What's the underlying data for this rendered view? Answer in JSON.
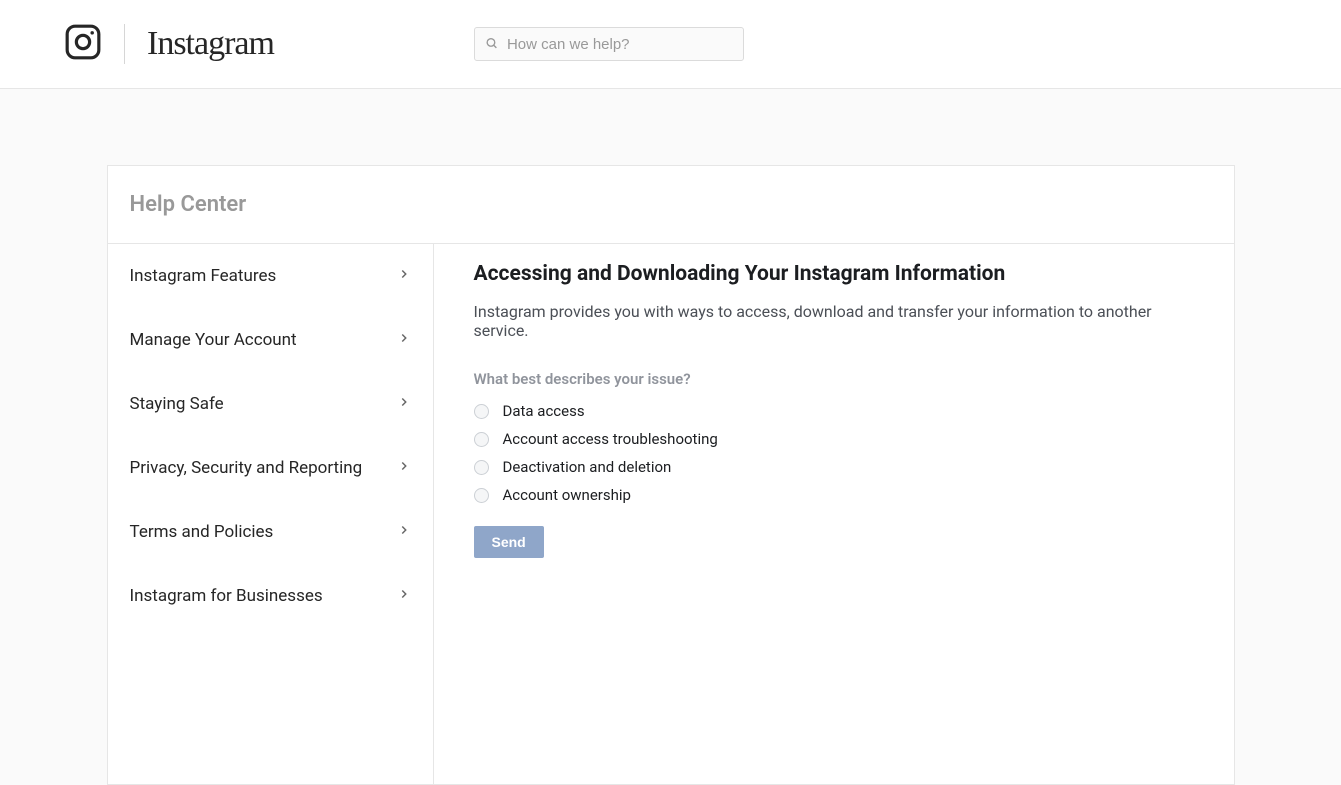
{
  "header": {
    "brand": "Instagram",
    "search_placeholder": "How can we help?"
  },
  "card": {
    "title": "Help Center"
  },
  "sidebar": {
    "items": [
      {
        "label": "Instagram Features"
      },
      {
        "label": "Manage Your Account"
      },
      {
        "label": "Staying Safe"
      },
      {
        "label": "Privacy, Security and Reporting"
      },
      {
        "label": "Terms and Policies"
      },
      {
        "label": "Instagram for Businesses"
      }
    ]
  },
  "main": {
    "heading": "Accessing and Downloading Your Instagram Information",
    "intro": "Instagram provides you with ways to access, download and transfer your information to another service.",
    "question": "What best describes your issue?",
    "options": [
      {
        "label": "Data access"
      },
      {
        "label": "Account access troubleshooting"
      },
      {
        "label": "Deactivation and deletion"
      },
      {
        "label": "Account ownership"
      }
    ],
    "send_label": "Send"
  }
}
